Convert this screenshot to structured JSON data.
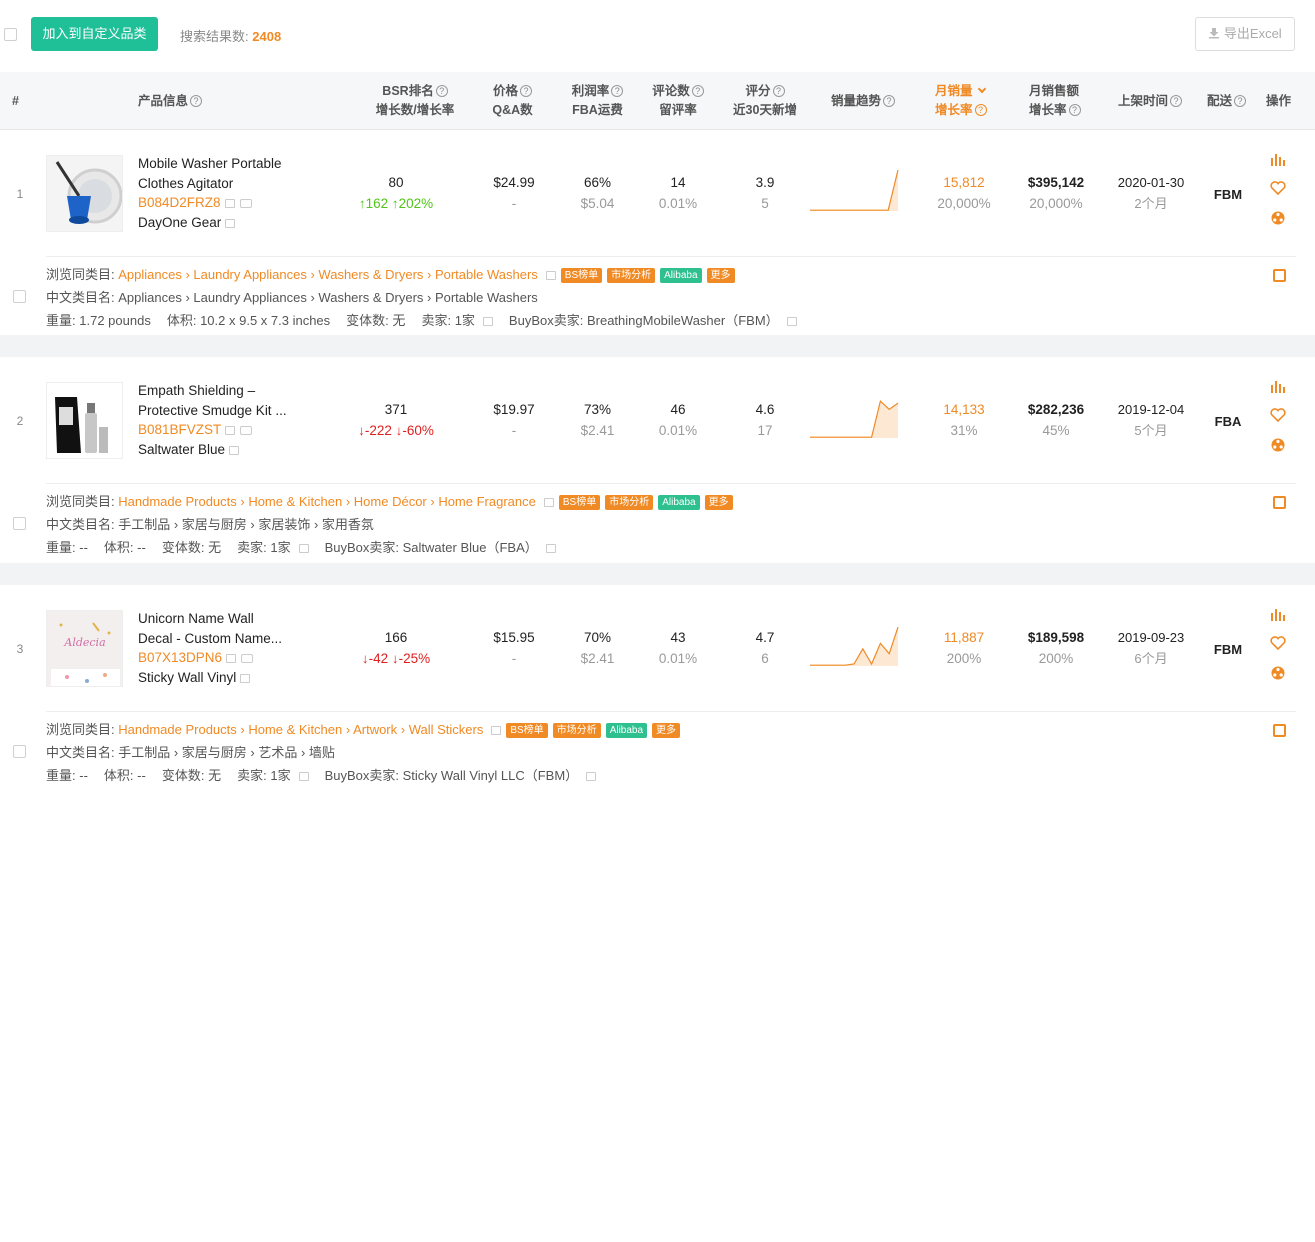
{
  "toolbar": {
    "add_label": "加入到自定义品类",
    "count_label": "搜索结果数:",
    "count_value": "2408",
    "export_label": "导出Excel"
  },
  "header": {
    "idx": "#",
    "product": "产品信息",
    "bsr1": "BSR排名",
    "bsr2": "增长数/增长率",
    "price1": "价格",
    "price2": "Q&A数",
    "profit1": "利润率",
    "profit2": "FBA运费",
    "review1": "评论数",
    "review2": "留评率",
    "rating1": "评分",
    "rating2": "近30天新增",
    "trend": "销量趋势",
    "msales1": "月销量",
    "msales2": "增长率",
    "mrev1": "月销售额",
    "mrev2": "增长率",
    "listed": "上架时间",
    "ship": "配送",
    "ops": "操作"
  },
  "labels": {
    "browse": "浏览同类目:",
    "cn_cat": "中文类目名:",
    "weight": "重量:",
    "volume": "体积:",
    "variants": "变体数:",
    "sellers": "卖家:",
    "buybox": "BuyBox卖家:",
    "tag_bs": "BS榜单",
    "tag_market": "市场分析",
    "tag_alibaba": "Alibaba",
    "tag_more": "更多"
  },
  "rows": [
    {
      "idx": "1",
      "name1": "Mobile Washer Portable",
      "name2": "Clothes Agitator",
      "asin": "B084D2FRZ8",
      "brand": "DayOne Gear",
      "bsr": "80",
      "bsr_change": "↑162",
      "bsr_rate": "↑202%",
      "price": "$24.99",
      "qa": "-",
      "profit": "66%",
      "fba": "$5.04",
      "reviews": "14",
      "review_rate": "0.01%",
      "rating": "3.9",
      "rating_new": "5",
      "msales": "15,812",
      "msales_rate": "20,000%",
      "mrev": "$395,142",
      "mrev_rate": "20,000%",
      "date": "2020-01-30",
      "age": "2个月",
      "ship": "FBM",
      "trend": [
        0.02,
        0.02,
        0.02,
        0.02,
        0.02,
        0.02,
        0.02,
        0.02,
        0.02,
        1.0
      ],
      "browse": "Appliances › Laundry Appliances › Washers & Dryers › Portable Washers",
      "cn_cat": "Appliances › Laundry Appliances › Washers & Dryers › Portable Washers",
      "weight": "1.72 pounds",
      "volume": "10.2 x 9.5 x 7.3 inches",
      "variants": "无",
      "sellers": "1家",
      "buybox": "BreathingMobileWasher（FBM）"
    },
    {
      "idx": "2",
      "name1": "Empath Shielding –",
      "name2": "Protective Smudge Kit ...",
      "asin": "B081BFVZST",
      "brand": "Saltwater Blue",
      "bsr": "371",
      "bsr_change": "↓-222",
      "bsr_rate": "↓-60%",
      "price": "$19.97",
      "qa": "-",
      "profit": "73%",
      "fba": "$2.41",
      "reviews": "46",
      "review_rate": "0.01%",
      "rating": "4.6",
      "rating_new": "17",
      "msales": "14,133",
      "msales_rate": "31%",
      "mrev": "$282,236",
      "mrev_rate": "45%",
      "date": "2019-12-04",
      "age": "5个月",
      "ship": "FBA",
      "trend": [
        0.02,
        0.02,
        0.02,
        0.02,
        0.02,
        0.02,
        0.02,
        0.02,
        0.9,
        0.7,
        0.85
      ],
      "browse": "Handmade Products › Home & Kitchen › Home Décor › Home Fragrance",
      "cn_cat": "手工制品 › 家居与厨房 › 家居装饰 › 家用香氛",
      "weight": "--",
      "volume": "--",
      "variants": "无",
      "sellers": "1家",
      "buybox": "Saltwater Blue（FBA）"
    },
    {
      "idx": "3",
      "name1": "Unicorn Name Wall",
      "name2": "Decal - Custom Name...",
      "asin": "B07X13DPN6",
      "brand": "Sticky Wall Vinyl",
      "bsr": "166",
      "bsr_change": "↓-42",
      "bsr_rate": "↓-25%",
      "price": "$15.95",
      "qa": "-",
      "profit": "70%",
      "fba": "$2.41",
      "reviews": "43",
      "review_rate": "0.01%",
      "rating": "4.7",
      "rating_new": "6",
      "msales": "11,887",
      "msales_rate": "200%",
      "mrev": "$189,598",
      "mrev_rate": "200%",
      "date": "2019-09-23",
      "age": "6个月",
      "ship": "FBM",
      "trend": [
        0.02,
        0.02,
        0.02,
        0.02,
        0.02,
        0.05,
        0.42,
        0.05,
        0.55,
        0.3,
        0.95
      ],
      "browse": "Handmade Products › Home & Kitchen › Artwork › Wall Stickers",
      "cn_cat": "手工制品 › 家居与厨房 › 艺术品 › 墙贴",
      "weight": "--",
      "volume": "--",
      "variants": "无",
      "sellers": "1家",
      "buybox": "Sticky Wall Vinyl LLC（FBM）"
    }
  ],
  "colors": {
    "accent": "#f08a24",
    "primary": "#1fbf98",
    "up": "#52c41a",
    "down": "#e02020"
  }
}
